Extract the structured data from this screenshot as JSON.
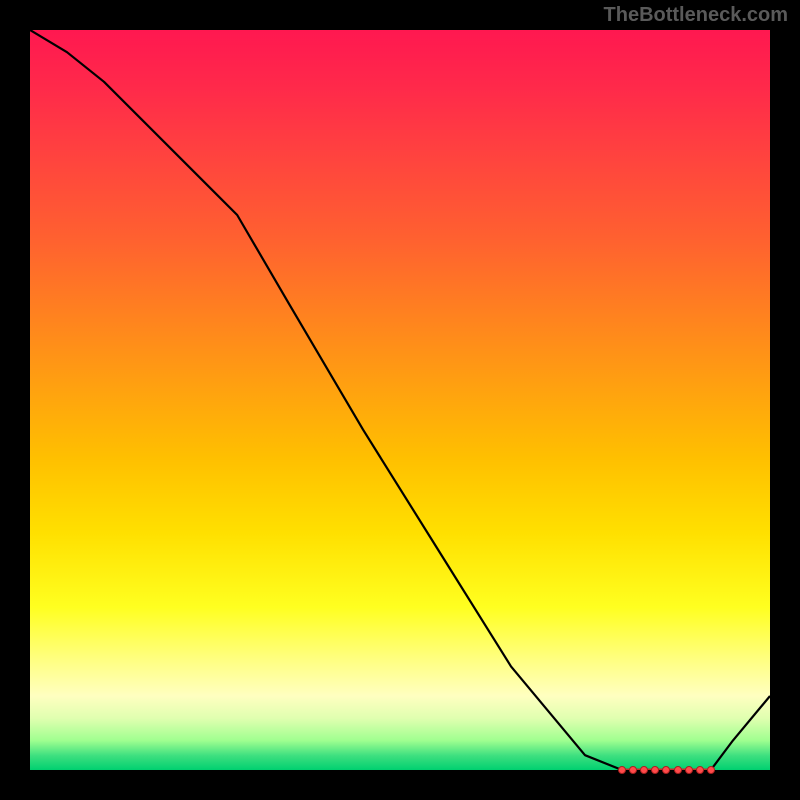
{
  "watermark": "TheBottleneck.com",
  "chart_data": {
    "type": "line",
    "title": "",
    "xlabel": "",
    "ylabel": "",
    "xlim": [
      0,
      100
    ],
    "ylim": [
      0,
      100
    ],
    "x": [
      0,
      5,
      10,
      15,
      20,
      25,
      28,
      35,
      45,
      55,
      65,
      75,
      80,
      82,
      84,
      86,
      88,
      90,
      92,
      95,
      100
    ],
    "values": [
      100,
      97,
      93,
      88,
      83,
      78,
      75,
      63,
      46,
      30,
      14,
      2,
      0,
      0,
      0,
      0,
      0,
      0,
      0,
      4,
      10
    ],
    "marker_segment": {
      "x_start": 80,
      "x_end": 92,
      "y": 0
    }
  },
  "colors": {
    "line": "#000000",
    "marker_fill": "#ff4a4a",
    "marker_stroke": "#aa2020",
    "bg_top": "#ff1850",
    "bg_bottom": "#00d070"
  }
}
